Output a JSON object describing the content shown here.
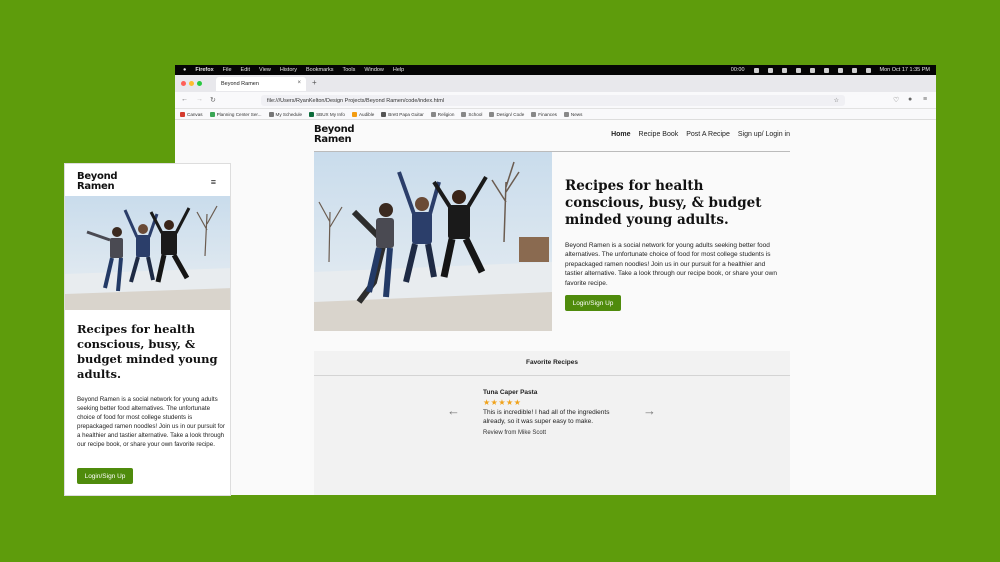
{
  "menubar": {
    "app": "Firefox",
    "items": [
      "File",
      "Edit",
      "View",
      "History",
      "Bookmarks",
      "Tools",
      "Window",
      "Help"
    ],
    "time_left": "00:00",
    "clock": "Mon Oct 17  1:35 PM"
  },
  "browser": {
    "tab_title": "Beyond Ramen",
    "tab_close": "×",
    "new_tab": "+",
    "url": "file:///Users/RyanKelton/Design Projects/Beyond Ramen/code/index.html",
    "bookmarks": [
      "Canvas",
      "Planning Center Ser...",
      "My Schedule",
      "SBUX My Info",
      "Audible",
      "Brett Papa Guitar",
      "Religion",
      "School",
      "Design/ Code",
      "Finances",
      "News"
    ]
  },
  "site": {
    "logo_line1": "Beyond",
    "logo_line2": "Ramen",
    "nav": [
      "Home",
      "Recipe Book",
      "Post A Recipe",
      "Sign up/ Login in"
    ],
    "hero_title": "Recipes for health conscious, busy, & budget minded young adults.",
    "hero_body": "Beyond Ramen is a social network for young adults seeking better food alternatives. The unfortunate choice of food for most college students is prepackaged ramen noodles! Join us in our pursuit for a healthier and tastier alternative. Take a look through our recipe book, or share your own favorite recipe.",
    "cta": "Login/Sign Up",
    "favorites": {
      "title": "Favorite Recipes",
      "recipe_name": "Tuna Caper Pasta",
      "stars": "★★★★★",
      "rating": 5,
      "quote": "This is incredible! I had all of the ingredients already, so it was super easy to make.",
      "byline": "Review from Mike Scott",
      "prev": "←",
      "next": "→"
    }
  },
  "mobile": {
    "logo_line1": "Beyond",
    "logo_line2": "Ramen",
    "menu_icon": "≡",
    "title": "Recipes for health conscious, busy, & budget minded young adults.",
    "body": "Beyond Ramen is a social network for young adults seeking better food alternatives. The unfortunate choice of food for most college students is prepackaged ramen noodles! Join us in our pursuit for a healthier and tastier alternative. Take a look through our recipe book, or share your own favorite recipe.",
    "cta": "Login/Sign Up"
  },
  "colors": {
    "background": "#5e9c0c",
    "brand_green": "#4f8b0c",
    "star": "#f0a21a"
  }
}
